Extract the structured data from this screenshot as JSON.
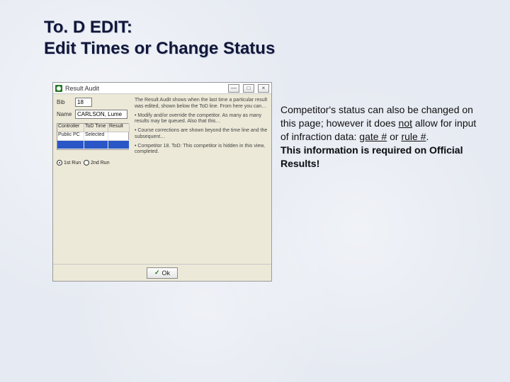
{
  "title_line1": "To. D EDIT:",
  "title_line2": "Edit Times or Change Status",
  "dialog": {
    "window_title": "Result Audit",
    "bib_label": "Bib",
    "bib_value": "18",
    "name_label": "Name",
    "name_value": "CARLSON, Lume",
    "grid": {
      "col1": "Controller",
      "col2": "ToD Time",
      "col3": "Result",
      "row1c1": "Public PC",
      "row1c2": "Selected",
      "row1c3": "",
      "row2c1": "",
      "row2c2": "",
      "row2c3": ""
    },
    "radio1": "1st Run",
    "radio2": "2nd Run",
    "audit_p1": "The Result Audit shows when the last time a particular result was edited, shown below the ToD line. From here you can…",
    "audit_p2": "• Modify and/or override the competitor. As many as many results may be queued. Also that this…",
    "audit_p3": "• Course corrections are shown beyond the time line and the subsequent…",
    "audit_p4": "• Competitor 18. ToD: This competitor is hidden in this view, completed.",
    "ok_label": "Ok"
  },
  "caption": {
    "p1a": "Competitor's status can also be changed on this page; however it does ",
    "not": "not",
    "p1b": " allow for input of infraction data: ",
    "gate": "gate #",
    "or": " or ",
    "rule": "rule #",
    "tail": ".",
    "bold": "This information is required on Official Results!"
  }
}
